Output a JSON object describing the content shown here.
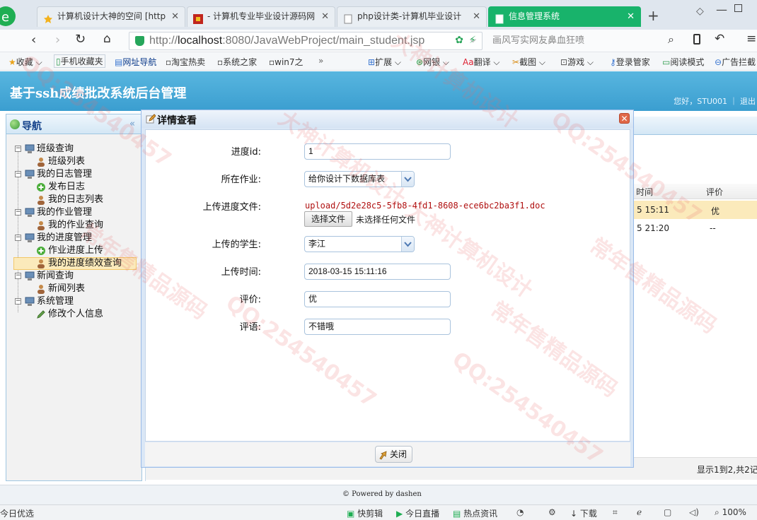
{
  "browser": {
    "tabs": [
      {
        "title": "计算机设计大神的空间 [http:"
      },
      {
        "title": "- 计算机专业毕业设计源码网"
      },
      {
        "title": "php设计类-计算机毕业设计"
      },
      {
        "title": "信息管理系统"
      }
    ],
    "url_prefix": "http://",
    "url_host": "localhost",
    "url_rest": ":8080/JavaWebProject/main_student.jsp",
    "search_hint": "画风写实网友鼻血狂喷",
    "bookmarks": {
      "favorites": "收藏",
      "mobile": "手机收藏夹",
      "nav": "网址导航",
      "taobao": "淘宝热卖",
      "syszj": "系统之家",
      "win7": "win7之",
      "ext": "扩展",
      "bank": "网银",
      "translate": "翻译",
      "screenshot": "截图",
      "games": "游戏",
      "login": "登录管家",
      "reader": "阅读模式",
      "adblock": "广告拦截"
    }
  },
  "app": {
    "title": "基于ssh成绩批改系统后台管理",
    "welcome": "您好，STU001 ｜ 退出"
  },
  "nav": {
    "title": "导航",
    "groups": [
      {
        "label": "班级查询",
        "items": [
          "班级列表"
        ]
      },
      {
        "label": "我的日志管理",
        "items": [
          "发布日志",
          "我的日志列表"
        ]
      },
      {
        "label": "我的作业管理",
        "items": [
          "我的作业查询"
        ]
      },
      {
        "label": "我的进度管理",
        "items": [
          "作业进度上传",
          "我的进度绩效查询"
        ]
      },
      {
        "label": "新闻查询",
        "items": [
          "新闻列表"
        ]
      },
      {
        "label": "系统管理",
        "items": [
          "修改个人信息"
        ]
      }
    ]
  },
  "grid": {
    "col_time": "时间",
    "col_rating": "评价",
    "rows": [
      {
        "time": "5 15:11",
        "rating": "优"
      },
      {
        "time": "5 21:20",
        "rating": "--"
      }
    ],
    "pager": "显示1到2,共2记"
  },
  "dialog": {
    "title": "详情查看",
    "fields": {
      "progress_id_label": "进度id:",
      "progress_id": "1",
      "homework_label": "所在作业:",
      "homework": "给你设计下数据库表",
      "file_label": "上传进度文件:",
      "file_path": "upload/5d2e28c5-5fb8-4fd1-8608-ece6bc2ba3f1.doc",
      "choose_file": "选择文件",
      "no_file": "未选择任何文件",
      "student_label": "上传的学生:",
      "student": "李江",
      "time_label": "上传时间:",
      "time": "2018-03-15 15:11:16",
      "rating_label": "评价:",
      "rating": "优",
      "comment_label": "评语:",
      "comment": "不错哦"
    },
    "close": "关闭"
  },
  "footer": "© Powered by dashen",
  "statusbar": {
    "left": "今日优选",
    "kuaijianji": "快剪辑",
    "live": "今日直播",
    "hot": "热点资讯",
    "download": "下载",
    "zoom": "100%"
  },
  "watermarks": [
    "QQ:254540457",
    "大神计算机设计",
    "常年售精品源码"
  ]
}
